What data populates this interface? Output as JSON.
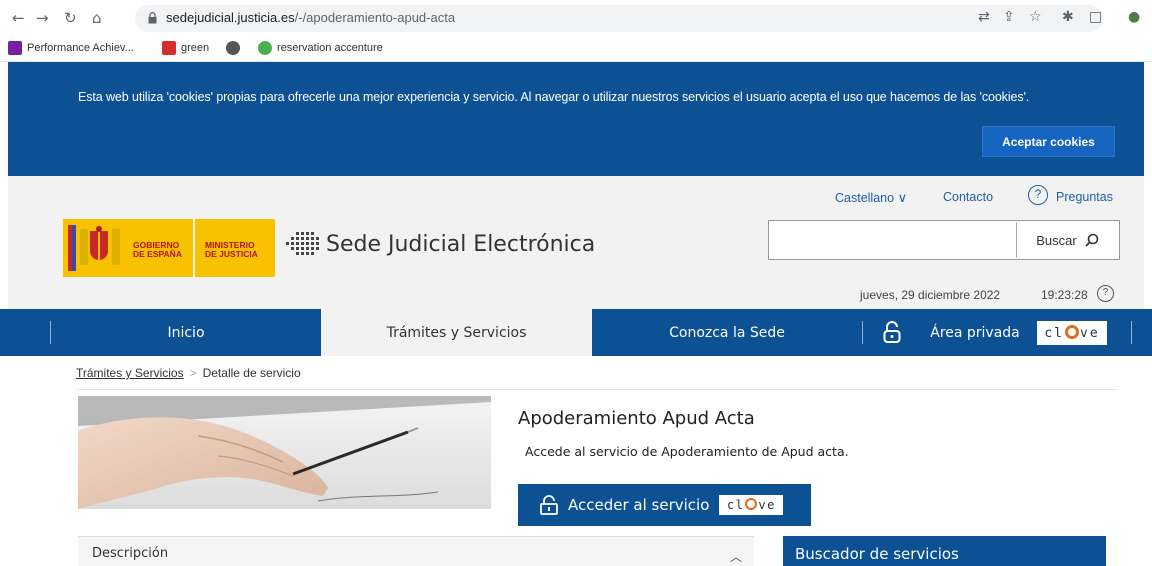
{
  "browser": {
    "url_host": "sedejudicial.justicia.es",
    "url_path": "/-/apoderamiento-apud-acta",
    "bookmarks": [
      {
        "label": "Performance Achiev...",
        "color": "#7b1fa2"
      },
      {
        "label": "green",
        "color": "#d32f2f"
      },
      {
        "label": "",
        "color": "#555555"
      },
      {
        "label": "reservation accenture",
        "color": "#4caf50"
      }
    ]
  },
  "cookies": {
    "text": "Esta web utiliza 'cookies' propias para ofrecerle una mejor experiencia y servicio. Al navegar o utilizar nuestros servicios el usuario acepta el uso que hacemos de las 'cookies'.",
    "accept_label": "Aceptar cookies"
  },
  "header": {
    "language": "Castellano",
    "contact": "Contacto",
    "questions": "Preguntas",
    "gov_line1": "GOBIERNO",
    "gov_line2": "DE ESPAÑA",
    "min_line1": "MINISTERIO",
    "min_line2": "DE JUSTICIA",
    "site_title": "Sede Judicial Electrónica",
    "search_value": "",
    "search_label": "Buscar",
    "date": "jueves, 29 diciembre 2022",
    "time": "19:23:28"
  },
  "nav": {
    "items": [
      "Inicio",
      "Trámites y Servicios",
      "Conozca la Sede",
      "Área privada"
    ],
    "active": "Trámites y Servicios",
    "badge_left": "cl",
    "badge_right": "ve"
  },
  "breadcrumb": {
    "parent": "Trámites y Servicios",
    "current": "Detalle de servicio"
  },
  "service": {
    "title": "Apoderamiento Apud Acta",
    "description": "Accede al servicio de Apoderamiento de Apud acta.",
    "button_label": "Acceder al servicio"
  },
  "panels": {
    "description_label": "Descripción",
    "search_services": "Buscador de servicios"
  },
  "colors": {
    "primary": "#0d5195",
    "header_bg": "#f2f2f2",
    "logo_yellow": "#f8c200",
    "clave_orange": "#e36d1d"
  }
}
